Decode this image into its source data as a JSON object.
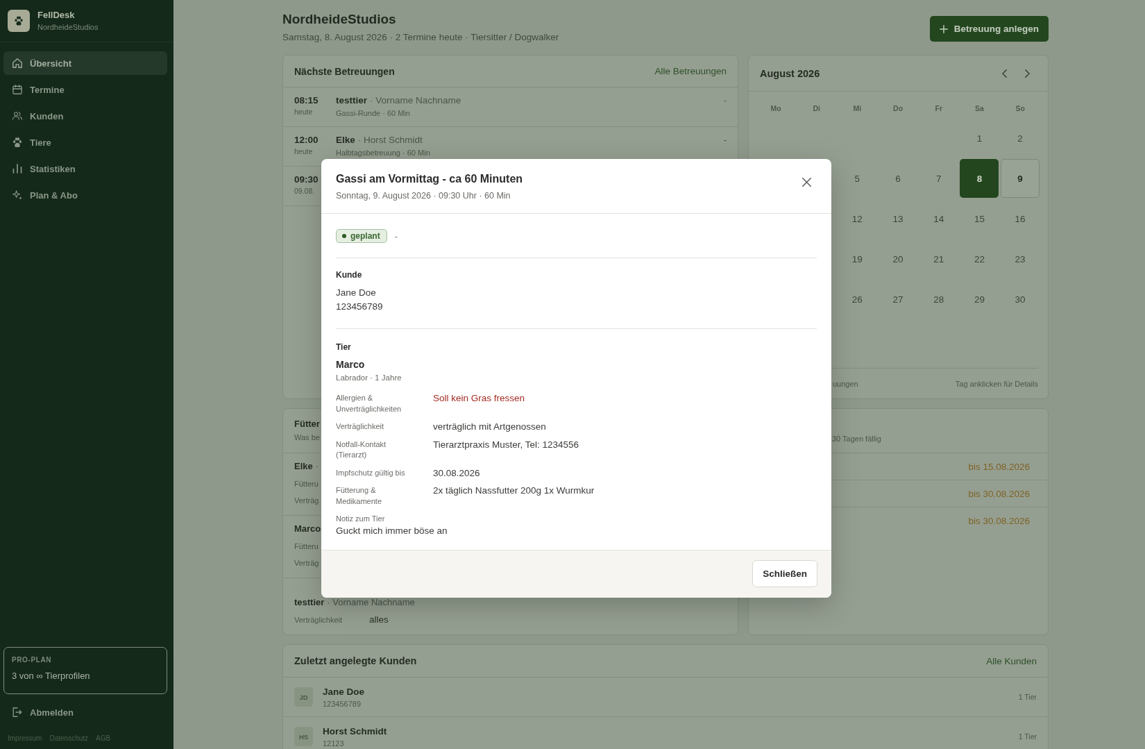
{
  "sidebar": {
    "brand": {
      "name": "FellDesk",
      "workspace": "NordheideStudios"
    },
    "nav": [
      {
        "label": "Übersicht",
        "selected": true
      },
      {
        "label": "Termine",
        "selected": false
      },
      {
        "label": "Kunden",
        "selected": false
      },
      {
        "label": "Tiere",
        "selected": false
      },
      {
        "label": "Statistiken",
        "selected": false
      },
      {
        "label": "Plan & Abo",
        "selected": false
      }
    ],
    "plan": {
      "name": "PRO-PLAN",
      "usage": "3 von ∞ Tierprofilen"
    },
    "logout": "Abmelden",
    "footer_links": [
      "Impressum",
      "Datenschutz",
      "AGB"
    ]
  },
  "header": {
    "title": "NordheideStudios",
    "subtitle": "Samstag, 8. August 2026 · 2 Termine heute · Tiersitter / Dogwalker",
    "action": "Betreuung anlegen"
  },
  "upcoming": {
    "title": "Nächste Betreuungen",
    "link": "Alle Betreuungen",
    "rows": [
      {
        "time": "08:15",
        "day": "heute",
        "pet": "testtier",
        "owner": "· Vorname Nachname",
        "service": "Gassi-Runde · 60 Min",
        "status": "-"
      },
      {
        "time": "12:00",
        "day": "heute",
        "pet": "Elke",
        "owner": "· Horst Schmidt",
        "service": "Halbtagsbetreuung · 60 Min",
        "status": "-"
      },
      {
        "time": "09:30",
        "day": "09.08."
      }
    ]
  },
  "calendar": {
    "title": "August 2026",
    "weekdays": [
      "Mo",
      "Di",
      "Mi",
      "Do",
      "Fr",
      "Sa",
      "So"
    ],
    "weeks": [
      [
        {
          "day": "1",
          "today": false,
          "has_bookings": false
        },
        {
          "day": "2",
          "today": false,
          "has_bookings": false
        }
      ],
      [
        {
          "day": "5",
          "today": false,
          "has_bookings": false
        },
        {
          "day": "6",
          "today": false,
          "has_bookings": false
        },
        {
          "day": "7",
          "today": false,
          "has_bookings": false
        },
        {
          "day": "8",
          "today": true,
          "has_bookings": false
        },
        {
          "day": "9",
          "today": false,
          "has_bookings": true
        }
      ],
      [
        {
          "day": "12",
          "today": false,
          "has_bookings": false
        },
        {
          "day": "13",
          "today": false,
          "has_bookings": false
        },
        {
          "day": "14",
          "today": false,
          "has_bookings": false
        },
        {
          "day": "15",
          "today": false,
          "has_bookings": false
        },
        {
          "day": "16",
          "today": false,
          "has_bookings": false
        }
      ],
      [
        {
          "day": "19",
          "today": false,
          "has_bookings": false
        },
        {
          "day": "20",
          "today": false,
          "has_bookings": false
        },
        {
          "day": "21",
          "today": false,
          "has_bookings": false
        },
        {
          "day": "22",
          "today": false,
          "has_bookings": false
        },
        {
          "day": "23",
          "today": false,
          "has_bookings": false
        }
      ],
      [
        {
          "day": "26",
          "today": false,
          "has_bookings": false
        },
        {
          "day": "27",
          "today": false,
          "has_bookings": false
        },
        {
          "day": "28",
          "today": false,
          "has_bookings": false
        },
        {
          "day": "29",
          "today": false,
          "has_bookings": false
        },
        {
          "day": "30",
          "today": false,
          "has_bookings": false
        }
      ]
    ],
    "legend": "uungen",
    "hint": "Tag anklicken für Details"
  },
  "feeding": {
    "title": "Fütter",
    "subtitle": "Was be",
    "rows": [
      {
        "pet": "Elke",
        "owner": "·",
        "fields": [
          {
            "label": "Fütteru"
          },
          {
            "label": "Verträg"
          }
        ]
      },
      {
        "pet": "Marco",
        "fields": [
          {
            "label": "Fütteru"
          },
          {
            "label": "Verträg"
          }
        ]
      },
      {
        "pet": "testtier",
        "owner": "· Vorname Nachname",
        "fields": [
          {
            "label": "Verträglichkeit",
            "value": "alles"
          }
        ]
      }
    ]
  },
  "due_soon": {
    "subtitle": "30 Tagen fällig",
    "rows": [
      {
        "due": "bis 15.08.2026"
      },
      {
        "due": "bis 30.08.2026"
      },
      {
        "due": "bis 30.08.2026"
      }
    ]
  },
  "customers": {
    "title": "Zuletzt angelegte Kunden",
    "link": "Alle Kunden",
    "rows": [
      {
        "initials": "JD",
        "name": "Jane Doe",
        "detail": "123456789",
        "pets": "1 Tier"
      },
      {
        "initials": "HS",
        "name": "Horst Schmidt",
        "detail": "12123",
        "pets": "1 Tier"
      }
    ]
  },
  "dialog": {
    "title": "Gassi am Vormittag - ca 60 Minuten",
    "subtitle": "Sonntag, 9. August 2026 · 09:30 Uhr · 60 Min",
    "status": {
      "label": "geplant",
      "kind": "planned"
    },
    "status_note": "-",
    "customer": {
      "heading": "Kunde",
      "name": "Jane Doe",
      "detail": "123456789"
    },
    "pet": {
      "heading": "Tier",
      "name": "Marco",
      "detail": "Labrador · 1 Jahre",
      "fields": [
        {
          "label": "Allergien & Unverträglichkeiten",
          "value": "Soll kein Gras fressen",
          "kind": "warning"
        },
        {
          "label": "Verträglichkeit",
          "value": "verträglich mit Artgenossen",
          "kind": "text"
        },
        {
          "label": "Notfall-Kontakt (Tierarzt)",
          "value": "Tierarztpraxis Muster, Tel: 1234556",
          "kind": "text"
        },
        {
          "label": "Impfschutz gültig bis",
          "value": "30.08.2026",
          "kind": "text"
        },
        {
          "label": "Fütterung & Medikamente",
          "value": "2x täglich Nassfutter 200g 1x Wurmkur",
          "kind": "text"
        }
      ],
      "note": {
        "label": "Notiz zum Tier",
        "value": "Guckt mich immer böse an"
      }
    },
    "close_button": "Schließen"
  }
}
